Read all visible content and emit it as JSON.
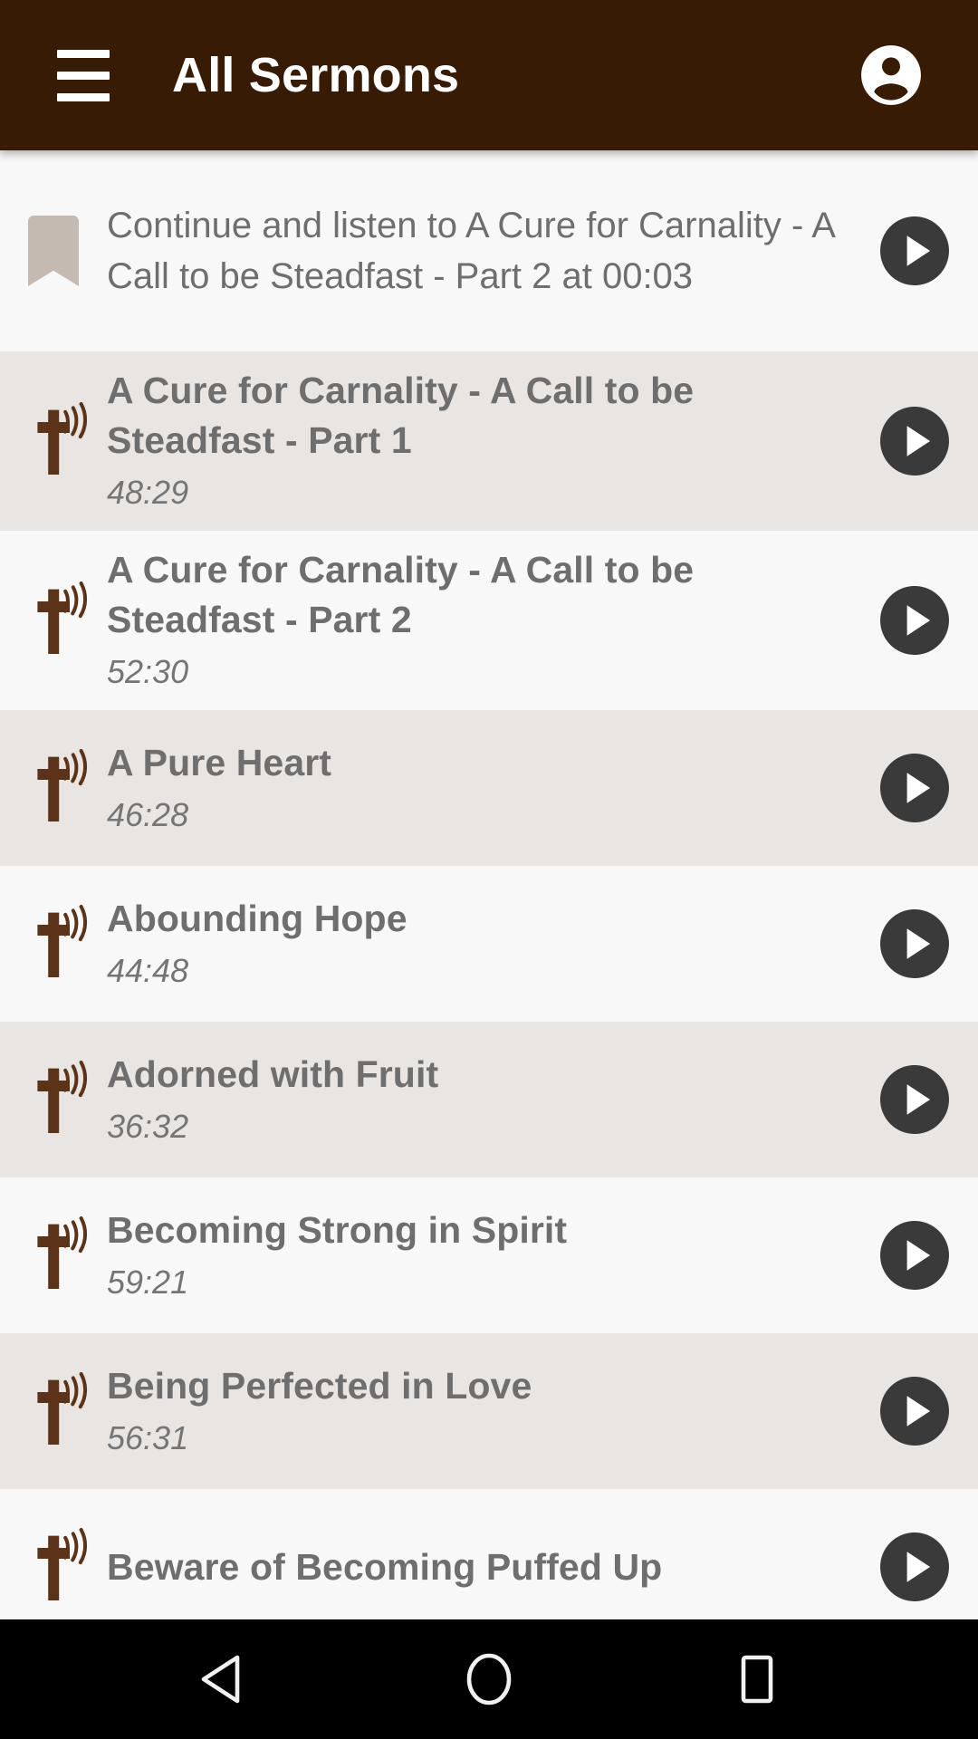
{
  "appbar": {
    "title": "All Sermons",
    "menu_icon": "hamburger-menu-icon",
    "account_icon": "account-circle-icon",
    "background_color": "#381b05",
    "text_color": "#ffffff"
  },
  "continue_banner": {
    "icon": "bookmark-icon",
    "icon_color": "#c4bab2",
    "text": "Continue and listen to A Cure for Carnality - A Call to be Steadfast - Part 2 at 00:03",
    "play_icon": "play-circle-icon"
  },
  "list": {
    "row_icon": "cross-with-sound-waves-icon",
    "row_icon_color": "#5a3318",
    "play_icon": "play-circle-icon",
    "play_icon_color": "#3a3a3a",
    "row_colors": [
      "#e8e5e3",
      "#f8f8f8"
    ],
    "items": [
      {
        "title": "A Cure for Carnality - A Call to be Steadfast - Part 1",
        "duration": "48:29"
      },
      {
        "title": "A Cure for Carnality - A Call to be Steadfast - Part 2",
        "duration": "52:30"
      },
      {
        "title": "A Pure Heart",
        "duration": "46:28"
      },
      {
        "title": "Abounding Hope",
        "duration": "44:48"
      },
      {
        "title": "Adorned with Fruit",
        "duration": "36:32"
      },
      {
        "title": "Becoming Strong in Spirit",
        "duration": "59:21"
      },
      {
        "title": "Being Perfected in Love",
        "duration": "56:31"
      },
      {
        "title": "Beware of Becoming Puffed Up",
        "duration": ""
      }
    ]
  },
  "navbar": {
    "background_color": "#000000",
    "buttons": [
      {
        "name": "back-button",
        "icon": "back-triangle-icon"
      },
      {
        "name": "home-button",
        "icon": "home-circle-icon"
      },
      {
        "name": "recents-button",
        "icon": "recents-square-icon"
      }
    ]
  }
}
